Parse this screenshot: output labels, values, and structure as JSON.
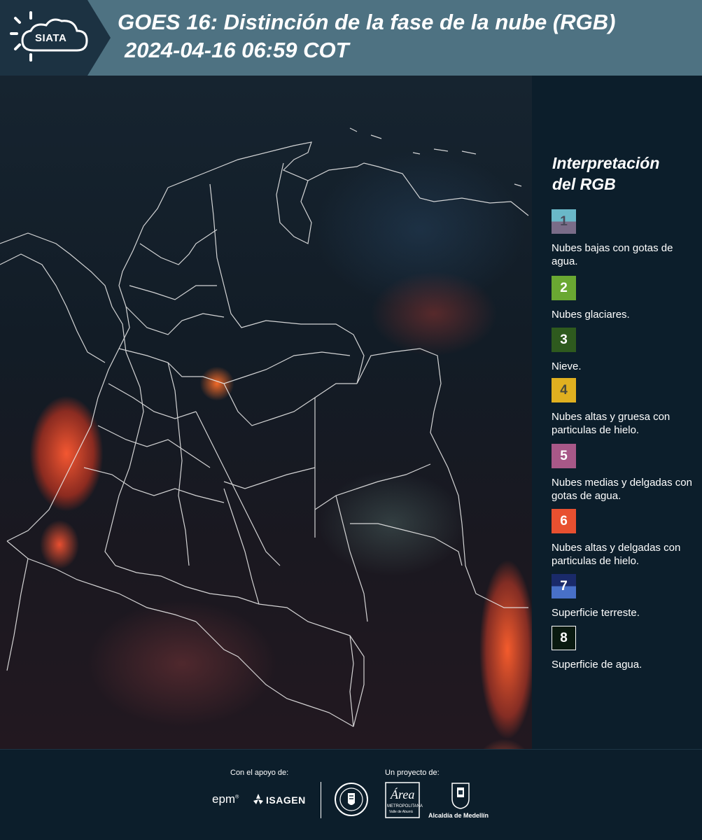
{
  "header": {
    "logo_text": "SIATA",
    "title": "GOES 16: Distinción de la fase de la nube (RGB)",
    "subtitle": "2024-04-16 06:59 COT",
    "bg_color": "#4e7282",
    "logo_bg_color": "#1c3242"
  },
  "legend": {
    "title_line1": "Interpretación",
    "title_line2": "del RGB",
    "items": [
      {
        "number": "1",
        "label": "Nubes bajas con gotas de agua.",
        "color_top": "#6ab8c8",
        "color_bottom": "#7a6c88",
        "text_color": "#4a4a5a"
      },
      {
        "number": "2",
        "label": "Nubes glaciares.",
        "color_top": "#6aa832",
        "color_bottom": "#6aa832",
        "text_color": "#ffffff"
      },
      {
        "number": "3",
        "label": "Nieve.",
        "color_top": "#2e5a1e",
        "color_bottom": "#2e5a1e",
        "text_color": "#ffffff"
      },
      {
        "number": "4",
        "label": "Nubes altas y gruesa con particulas de hielo.",
        "color_top": "#e0b020",
        "color_bottom": "#e0b020",
        "text_color": "#4a4a3a"
      },
      {
        "number": "5",
        "label": "Nubes medias y delgadas con gotas de agua.",
        "color_top": "#a85888",
        "color_bottom": "#a85888",
        "text_color": "#ffffff"
      },
      {
        "number": "6",
        "label": "Nubes altas y delgadas con particulas de hielo.",
        "color_top": "#e85030",
        "color_bottom": "#e85030",
        "text_color": "#ffffff"
      },
      {
        "number": "7",
        "label": "Superficie terreste.",
        "color_top": "#1a2a6a",
        "color_bottom": "#4870c8",
        "text_color": "#ffffff"
      },
      {
        "number": "8",
        "label": "Superficie de agua.",
        "color_top": "#0a1a10",
        "color_bottom": "#0a1a10",
        "text_color": "#ffffff"
      }
    ]
  },
  "footer": {
    "support_label": "Con el apoyo de:",
    "project_label": "Un proyecto de:",
    "sponsor1": "epm",
    "sponsor2": "ISAGEN",
    "partner1_text": "METROPOLITANA",
    "partner1_sub": "Valle de Aburrá",
    "partner1_script": "Área",
    "partner2": "Alcaldía de Medellín"
  }
}
